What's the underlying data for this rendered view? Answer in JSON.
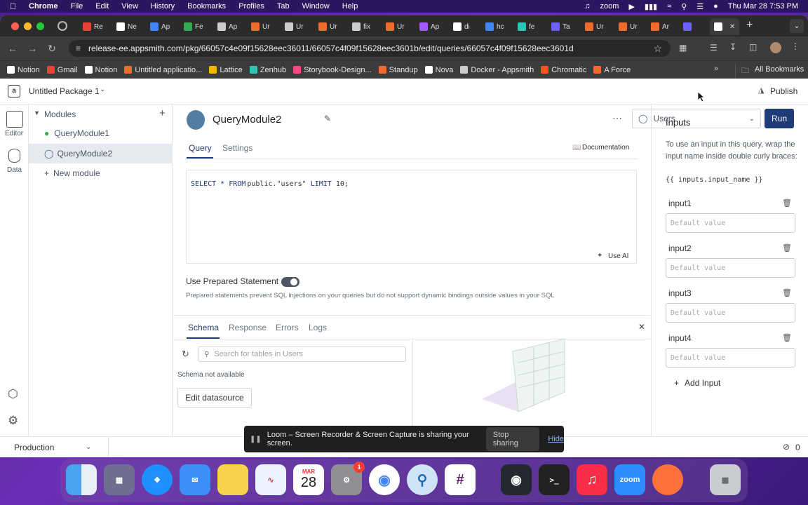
{
  "menubar": {
    "app": "Chrome",
    "items": [
      "File",
      "Edit",
      "View",
      "History",
      "Bookmarks",
      "Profiles",
      "Tab",
      "Window",
      "Help"
    ],
    "zoom": "zoom",
    "datetime": "Thu Mar 28  7:53 PM"
  },
  "tabs": [
    {
      "label": "Re",
      "color": "#ea4335"
    },
    {
      "label": "Ne",
      "color": "#ffffff"
    },
    {
      "label": "Ap",
      "color": "#4285f4"
    },
    {
      "label": "Fe",
      "color": "#34a853"
    },
    {
      "label": "Ap",
      "color": "#cccccc"
    },
    {
      "label": "Ur",
      "color": "#ef6c2f"
    },
    {
      "label": "Ur",
      "color": "#cccccc"
    },
    {
      "label": "Ur",
      "color": "#ef6c2f"
    },
    {
      "label": "fix",
      "color": "#cccccc"
    },
    {
      "label": "Ur",
      "color": "#ef6c2f"
    },
    {
      "label": "Ap",
      "color": "#a259ff"
    },
    {
      "label": "di",
      "color": "#ffffff"
    },
    {
      "label": "hc",
      "color": "#4285f4"
    },
    {
      "label": "fe",
      "color": "#2ec4b6"
    },
    {
      "label": "Ta",
      "color": "#6c63ff"
    },
    {
      "label": "Ur",
      "color": "#ef6c2f"
    },
    {
      "label": "Ur",
      "color": "#ef6c2f"
    },
    {
      "label": "Ar",
      "color": "#ef6c2f"
    },
    {
      "label": "",
      "color": "#6c63ff"
    }
  ],
  "url": "release-ee.appsmith.com/pkg/66057c4e09f15628eec36011/66057c4f09f15628eec3601b/edit/queries/66057c4f09f15628eec3601d",
  "bookmarks": [
    {
      "label": "Notion",
      "color": "#ffffff"
    },
    {
      "label": "Gmail",
      "color": "#ea4335"
    },
    {
      "label": "Notion",
      "color": "#ffffff"
    },
    {
      "label": "Untitled applicatio...",
      "color": "#ef6c2f"
    },
    {
      "label": "Lattice",
      "color": "#f4b400"
    },
    {
      "label": "Zenhub",
      "color": "#2ec4b6"
    },
    {
      "label": "Storybook-Design...",
      "color": "#ff4785"
    },
    {
      "label": "Standup",
      "color": "#ef6c2f"
    },
    {
      "label": "Nova",
      "color": "#ffffff"
    },
    {
      "label": "Docker - Appsmith",
      "color": "#cccccc"
    },
    {
      "label": "Chromatic",
      "color": "#fc521f"
    },
    {
      "label": "A Force",
      "color": "#ef6c2f"
    }
  ],
  "all_bookmarks": "All Bookmarks",
  "app": {
    "package_name": "Untitled Package 1",
    "publish": "Publish",
    "rail": {
      "editor": "Editor",
      "data": "Data"
    },
    "modules_title": "Modules",
    "modules": [
      "QueryModule1",
      "QueryModule2"
    ],
    "new_module": "New module",
    "query_name": "QueryModule2",
    "datasource": "Users",
    "run": "Run",
    "tabs": {
      "query": "Query",
      "settings": "Settings"
    },
    "documentation": "Documentation",
    "sql": {
      "kw1": "SELECT",
      "star": "*",
      "kw2": "FROM",
      "table": "public.",
      "name": "\"users\"",
      "kw3": "LIMIT",
      "num": "10;"
    },
    "use_ai": "Use AI",
    "prepared_label": "Use Prepared Statement",
    "prepared_desc": "Prepared statements prevent SQL injections on your queries but do not support dynamic bindings outside values in your SQL",
    "bottom_tabs": [
      "Schema",
      "Response",
      "Errors",
      "Logs"
    ],
    "schema_search_placeholder": "Search for tables in Users",
    "schema_na": "Schema not available",
    "edit_datasource": "Edit datasource",
    "inputs_title": "Inputs",
    "inputs_help": "To use an input in this query, wrap the input name inside double curly braces:",
    "inputs_example": "{{ inputs.input_name }}",
    "inputs": [
      {
        "name": "input1",
        "placeholder": "Default value"
      },
      {
        "name": "input2",
        "placeholder": "Default value"
      },
      {
        "name": "input3",
        "placeholder": "Default value"
      },
      {
        "name": "input4",
        "placeholder": "Default value"
      }
    ],
    "add_input": "Add Input",
    "environment": "Production",
    "error_count": "0"
  },
  "loom": {
    "message": "Loom – Screen Recorder & Screen Capture is sharing your screen.",
    "stop": "Stop sharing",
    "hide": "Hide"
  },
  "dock": {
    "calendar_month": "MAR",
    "calendar_day": "28",
    "settings_badge": "1",
    "zoom": "zoom"
  }
}
